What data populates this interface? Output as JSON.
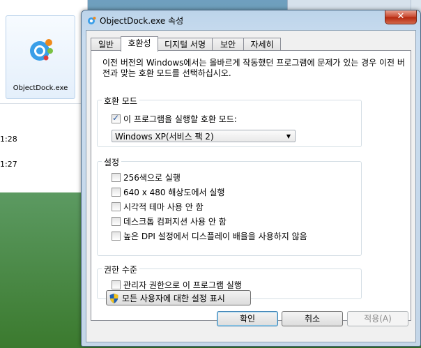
{
  "background": {
    "icon_label": "ObjectDock.exe",
    "times": [
      "1:28",
      "1:27"
    ]
  },
  "window": {
    "title": "ObjectDock.exe 속성",
    "close_glyph": "✕"
  },
  "tabs": [
    {
      "label": "일반"
    },
    {
      "label": "호환성",
      "active": true
    },
    {
      "label": "디지털 서명"
    },
    {
      "label": "보안"
    },
    {
      "label": "자세히"
    }
  ],
  "description": "이전 버전의 Windows에서는 올바르게 작동했던 프로그램에 문제가 있는 경우 이전 버전과 맞는 호환 모드를 선택하십시오.",
  "compat_mode": {
    "group_label": "호환 모드",
    "checkbox_label": "이 프로그램을 실행할 호환 모드:",
    "checked": true,
    "selected_value": "Windows XP(서비스 팩 2)"
  },
  "settings": {
    "group_label": "설정",
    "options": [
      {
        "label": "256색으로 실행",
        "checked": false
      },
      {
        "label": "640 x 480 해상도에서 실행",
        "checked": false
      },
      {
        "label": "시각적 테마 사용 안 함",
        "checked": false
      },
      {
        "label": "데스크톱 컴퍼지션 사용 안 함",
        "checked": false
      },
      {
        "label": "높은 DPI 설정에서 디스플레이 배율을 사용하지 않음",
        "checked": false
      }
    ]
  },
  "privilege": {
    "group_label": "권한 수준",
    "checkbox_label": "관리자 권한으로 이 프로그램 실행",
    "checked": false
  },
  "all_users_button": "모든 사용자에 대한 설정 표시",
  "buttons": {
    "ok": "확인",
    "cancel": "취소",
    "apply": "적용(A)"
  }
}
